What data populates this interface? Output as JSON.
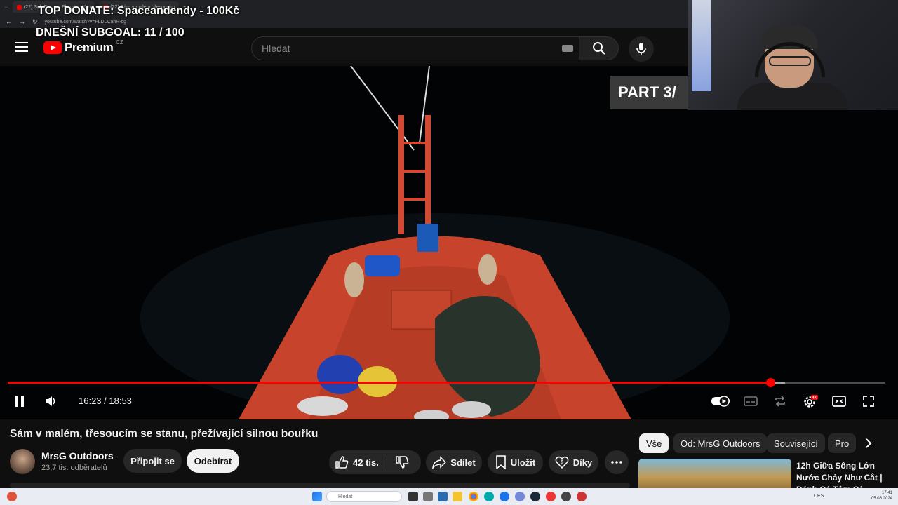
{
  "overlay": {
    "top_donate": "TOP DONATE: Spaceandendy - 100Kč",
    "subgoal": "DNEŠNÍ SUBGOAL: 11 / 100",
    "part_badge": "PART 3/"
  },
  "browser": {
    "tabs": [
      "(22) Sub Focus - Elevate - You",
      "(22) Sám v malém, třesoucím"
    ],
    "url": "youtube.com/watch?v=FLDLCahR-cg"
  },
  "header": {
    "logo_text": "Premium",
    "country": "CZ",
    "search_placeholder": "Hledat"
  },
  "player": {
    "current_time": "16:23",
    "duration": "18:53",
    "time_display": "16:23 / 18:53",
    "progress_fraction": 0.8694,
    "buffer_fraction": 0.886,
    "quality_badge": "4K"
  },
  "video_info": {
    "title": "Sám v malém, třesoucím se stanu, přežívající silnou bouřku",
    "channel_name": "MrsG Outdoors",
    "subscribers": "23,7 tis. odběratelů",
    "join_label": "Připojit se",
    "subscribe_label": "Odebírat",
    "likes": "42 tis.",
    "share_label": "Sdílet",
    "save_label": "Uložit",
    "thanks_label": "Díky"
  },
  "chips": [
    "Vše",
    "Od: MrsG Outdoors",
    "Související",
    "Pro"
  ],
  "recommendation": {
    "title": "12h Giữa Sông Lớn Nước Chảy Như Cắt | Đánh Cá Tôm Cả..."
  },
  "taskbar": {
    "search_placeholder": "Hledat",
    "tray_lang": "CES",
    "clock_time": "17:41",
    "clock_date": "05.06.2024"
  },
  "colors": {
    "accent": "#ff0000",
    "background": "#0f0f0f",
    "pill": "#272727"
  }
}
